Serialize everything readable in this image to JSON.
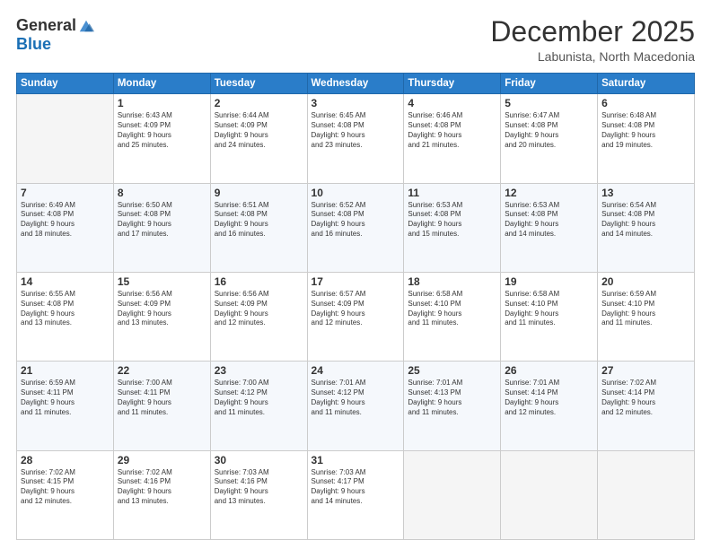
{
  "logo": {
    "general": "General",
    "blue": "Blue"
  },
  "header": {
    "title": "December 2025",
    "subtitle": "Labunista, North Macedonia"
  },
  "weekdays": [
    "Sunday",
    "Monday",
    "Tuesday",
    "Wednesday",
    "Thursday",
    "Friday",
    "Saturday"
  ],
  "weeks": [
    [
      {
        "day": "",
        "info": ""
      },
      {
        "day": "1",
        "info": "Sunrise: 6:43 AM\nSunset: 4:09 PM\nDaylight: 9 hours\nand 25 minutes."
      },
      {
        "day": "2",
        "info": "Sunrise: 6:44 AM\nSunset: 4:09 PM\nDaylight: 9 hours\nand 24 minutes."
      },
      {
        "day": "3",
        "info": "Sunrise: 6:45 AM\nSunset: 4:08 PM\nDaylight: 9 hours\nand 23 minutes."
      },
      {
        "day": "4",
        "info": "Sunrise: 6:46 AM\nSunset: 4:08 PM\nDaylight: 9 hours\nand 21 minutes."
      },
      {
        "day": "5",
        "info": "Sunrise: 6:47 AM\nSunset: 4:08 PM\nDaylight: 9 hours\nand 20 minutes."
      },
      {
        "day": "6",
        "info": "Sunrise: 6:48 AM\nSunset: 4:08 PM\nDaylight: 9 hours\nand 19 minutes."
      }
    ],
    [
      {
        "day": "7",
        "info": "Sunrise: 6:49 AM\nSunset: 4:08 PM\nDaylight: 9 hours\nand 18 minutes."
      },
      {
        "day": "8",
        "info": "Sunrise: 6:50 AM\nSunset: 4:08 PM\nDaylight: 9 hours\nand 17 minutes."
      },
      {
        "day": "9",
        "info": "Sunrise: 6:51 AM\nSunset: 4:08 PM\nDaylight: 9 hours\nand 16 minutes."
      },
      {
        "day": "10",
        "info": "Sunrise: 6:52 AM\nSunset: 4:08 PM\nDaylight: 9 hours\nand 16 minutes."
      },
      {
        "day": "11",
        "info": "Sunrise: 6:53 AM\nSunset: 4:08 PM\nDaylight: 9 hours\nand 15 minutes."
      },
      {
        "day": "12",
        "info": "Sunrise: 6:53 AM\nSunset: 4:08 PM\nDaylight: 9 hours\nand 14 minutes."
      },
      {
        "day": "13",
        "info": "Sunrise: 6:54 AM\nSunset: 4:08 PM\nDaylight: 9 hours\nand 14 minutes."
      }
    ],
    [
      {
        "day": "14",
        "info": "Sunrise: 6:55 AM\nSunset: 4:08 PM\nDaylight: 9 hours\nand 13 minutes."
      },
      {
        "day": "15",
        "info": "Sunrise: 6:56 AM\nSunset: 4:09 PM\nDaylight: 9 hours\nand 13 minutes."
      },
      {
        "day": "16",
        "info": "Sunrise: 6:56 AM\nSunset: 4:09 PM\nDaylight: 9 hours\nand 12 minutes."
      },
      {
        "day": "17",
        "info": "Sunrise: 6:57 AM\nSunset: 4:09 PM\nDaylight: 9 hours\nand 12 minutes."
      },
      {
        "day": "18",
        "info": "Sunrise: 6:58 AM\nSunset: 4:10 PM\nDaylight: 9 hours\nand 11 minutes."
      },
      {
        "day": "19",
        "info": "Sunrise: 6:58 AM\nSunset: 4:10 PM\nDaylight: 9 hours\nand 11 minutes."
      },
      {
        "day": "20",
        "info": "Sunrise: 6:59 AM\nSunset: 4:10 PM\nDaylight: 9 hours\nand 11 minutes."
      }
    ],
    [
      {
        "day": "21",
        "info": "Sunrise: 6:59 AM\nSunset: 4:11 PM\nDaylight: 9 hours\nand 11 minutes."
      },
      {
        "day": "22",
        "info": "Sunrise: 7:00 AM\nSunset: 4:11 PM\nDaylight: 9 hours\nand 11 minutes."
      },
      {
        "day": "23",
        "info": "Sunrise: 7:00 AM\nSunset: 4:12 PM\nDaylight: 9 hours\nand 11 minutes."
      },
      {
        "day": "24",
        "info": "Sunrise: 7:01 AM\nSunset: 4:12 PM\nDaylight: 9 hours\nand 11 minutes."
      },
      {
        "day": "25",
        "info": "Sunrise: 7:01 AM\nSunset: 4:13 PM\nDaylight: 9 hours\nand 11 minutes."
      },
      {
        "day": "26",
        "info": "Sunrise: 7:01 AM\nSunset: 4:14 PM\nDaylight: 9 hours\nand 12 minutes."
      },
      {
        "day": "27",
        "info": "Sunrise: 7:02 AM\nSunset: 4:14 PM\nDaylight: 9 hours\nand 12 minutes."
      }
    ],
    [
      {
        "day": "28",
        "info": "Sunrise: 7:02 AM\nSunset: 4:15 PM\nDaylight: 9 hours\nand 12 minutes."
      },
      {
        "day": "29",
        "info": "Sunrise: 7:02 AM\nSunset: 4:16 PM\nDaylight: 9 hours\nand 13 minutes."
      },
      {
        "day": "30",
        "info": "Sunrise: 7:03 AM\nSunset: 4:16 PM\nDaylight: 9 hours\nand 13 minutes."
      },
      {
        "day": "31",
        "info": "Sunrise: 7:03 AM\nSunset: 4:17 PM\nDaylight: 9 hours\nand 14 minutes."
      },
      {
        "day": "",
        "info": ""
      },
      {
        "day": "",
        "info": ""
      },
      {
        "day": "",
        "info": ""
      }
    ]
  ]
}
